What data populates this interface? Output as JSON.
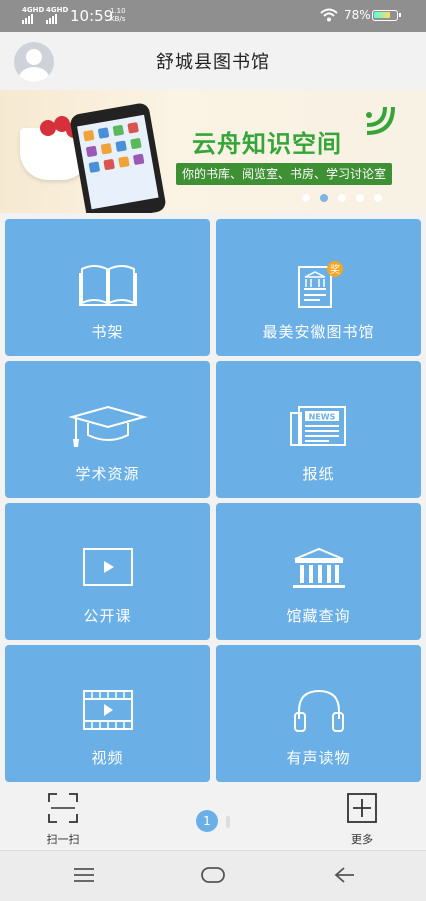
{
  "status_bar": {
    "sim1": "4GHD",
    "sim2": "4GHD",
    "time": "10:59",
    "net_speed_value": "1.10",
    "net_speed_unit": "KB/s",
    "battery": "78%",
    "battery_level": 0.78
  },
  "header": {
    "title": "舒城县图书馆"
  },
  "banner": {
    "title": "云舟知识空间",
    "subtitle": "你的书库、阅览室、书房、学习讨论室",
    "slide_count": 5,
    "active_slide": 2
  },
  "tiles": [
    {
      "label": "书架",
      "icon": "bookshelf-icon"
    },
    {
      "label": "最美安徽图书馆",
      "icon": "library-award-icon",
      "badge": "奖"
    },
    {
      "label": "学术资源",
      "icon": "graduation-cap-icon"
    },
    {
      "label": "报纸",
      "icon": "newspaper-icon",
      "news_text": "NEWS"
    },
    {
      "label": "公开课",
      "icon": "play-screen-icon"
    },
    {
      "label": "馆藏查询",
      "icon": "museum-building-icon"
    },
    {
      "label": "视频",
      "icon": "video-film-icon"
    },
    {
      "label": "有声读物",
      "icon": "headphones-icon"
    }
  ],
  "toolbar": {
    "scan_label": "扫一扫",
    "more_label": "更多",
    "page_indicator": "1"
  },
  "colors": {
    "tile": "#6ab0e6",
    "status_bar": "#8f8f8f",
    "banner_title": "#35a53a"
  }
}
